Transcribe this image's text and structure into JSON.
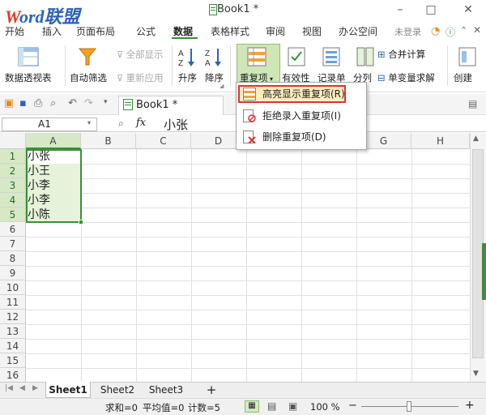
{
  "title_bar": {
    "logo_brand_w": "W",
    "logo_brand_rest": "ord联盟",
    "logo_url": "www.wordlm.com",
    "doc_title": "Book1 *"
  },
  "menu": {
    "tabs": [
      "开始",
      "插入",
      "页面布局",
      "公式",
      "数据",
      "表格样式",
      "审阅",
      "视图",
      "办公空间"
    ],
    "active_tab": "数据",
    "login": "未登录"
  },
  "ribbon": {
    "pivot_label": "数据透视表",
    "autofilter_label": "自动筛选",
    "show_all_label": "全部显示",
    "reapply_label": "重新应用",
    "sort_asc_label": "升序",
    "sort_desc_label": "降序",
    "duplicates_label": "重复项",
    "validity_label": "有效性",
    "record_label": "记录单",
    "split_label": "分列",
    "consolidate_label": "合并计算",
    "single_var_label": "单变量求解",
    "create_label": "创建"
  },
  "dropdown": {
    "items": [
      "高亮显示重复项(R)",
      "拒绝录入重复项(I)",
      "删除重复项(D)"
    ]
  },
  "quick_toolbar": {
    "doc_tab": "Book1 *"
  },
  "formula_bar": {
    "cell_ref": "A1",
    "fx_label": "fx",
    "value": "小张"
  },
  "grid": {
    "columns": [
      "A",
      "B",
      "C",
      "D",
      "E",
      "F",
      "G",
      "H"
    ],
    "rows": [
      "1",
      "2",
      "3",
      "4",
      "5",
      "6",
      "7",
      "8",
      "9",
      "10",
      "11",
      "12",
      "13",
      "14",
      "15",
      "16"
    ],
    "cells_A": [
      "小张",
      "小王",
      "小李",
      "小李",
      "小陈"
    ]
  },
  "sheets": {
    "tabs": [
      "Sheet1",
      "Sheet2",
      "Sheet3"
    ],
    "add": "+"
  },
  "status": {
    "sum": "求和=0",
    "avg": "平均值=0",
    "count": "计数=5",
    "zoom": "100 %",
    "zoom_minus": "−",
    "zoom_plus": "+"
  },
  "colors": {
    "accent_green": "#3a8f3a",
    "selection_fill": "#e6f2d9",
    "highlight_red": "#dd3333"
  }
}
